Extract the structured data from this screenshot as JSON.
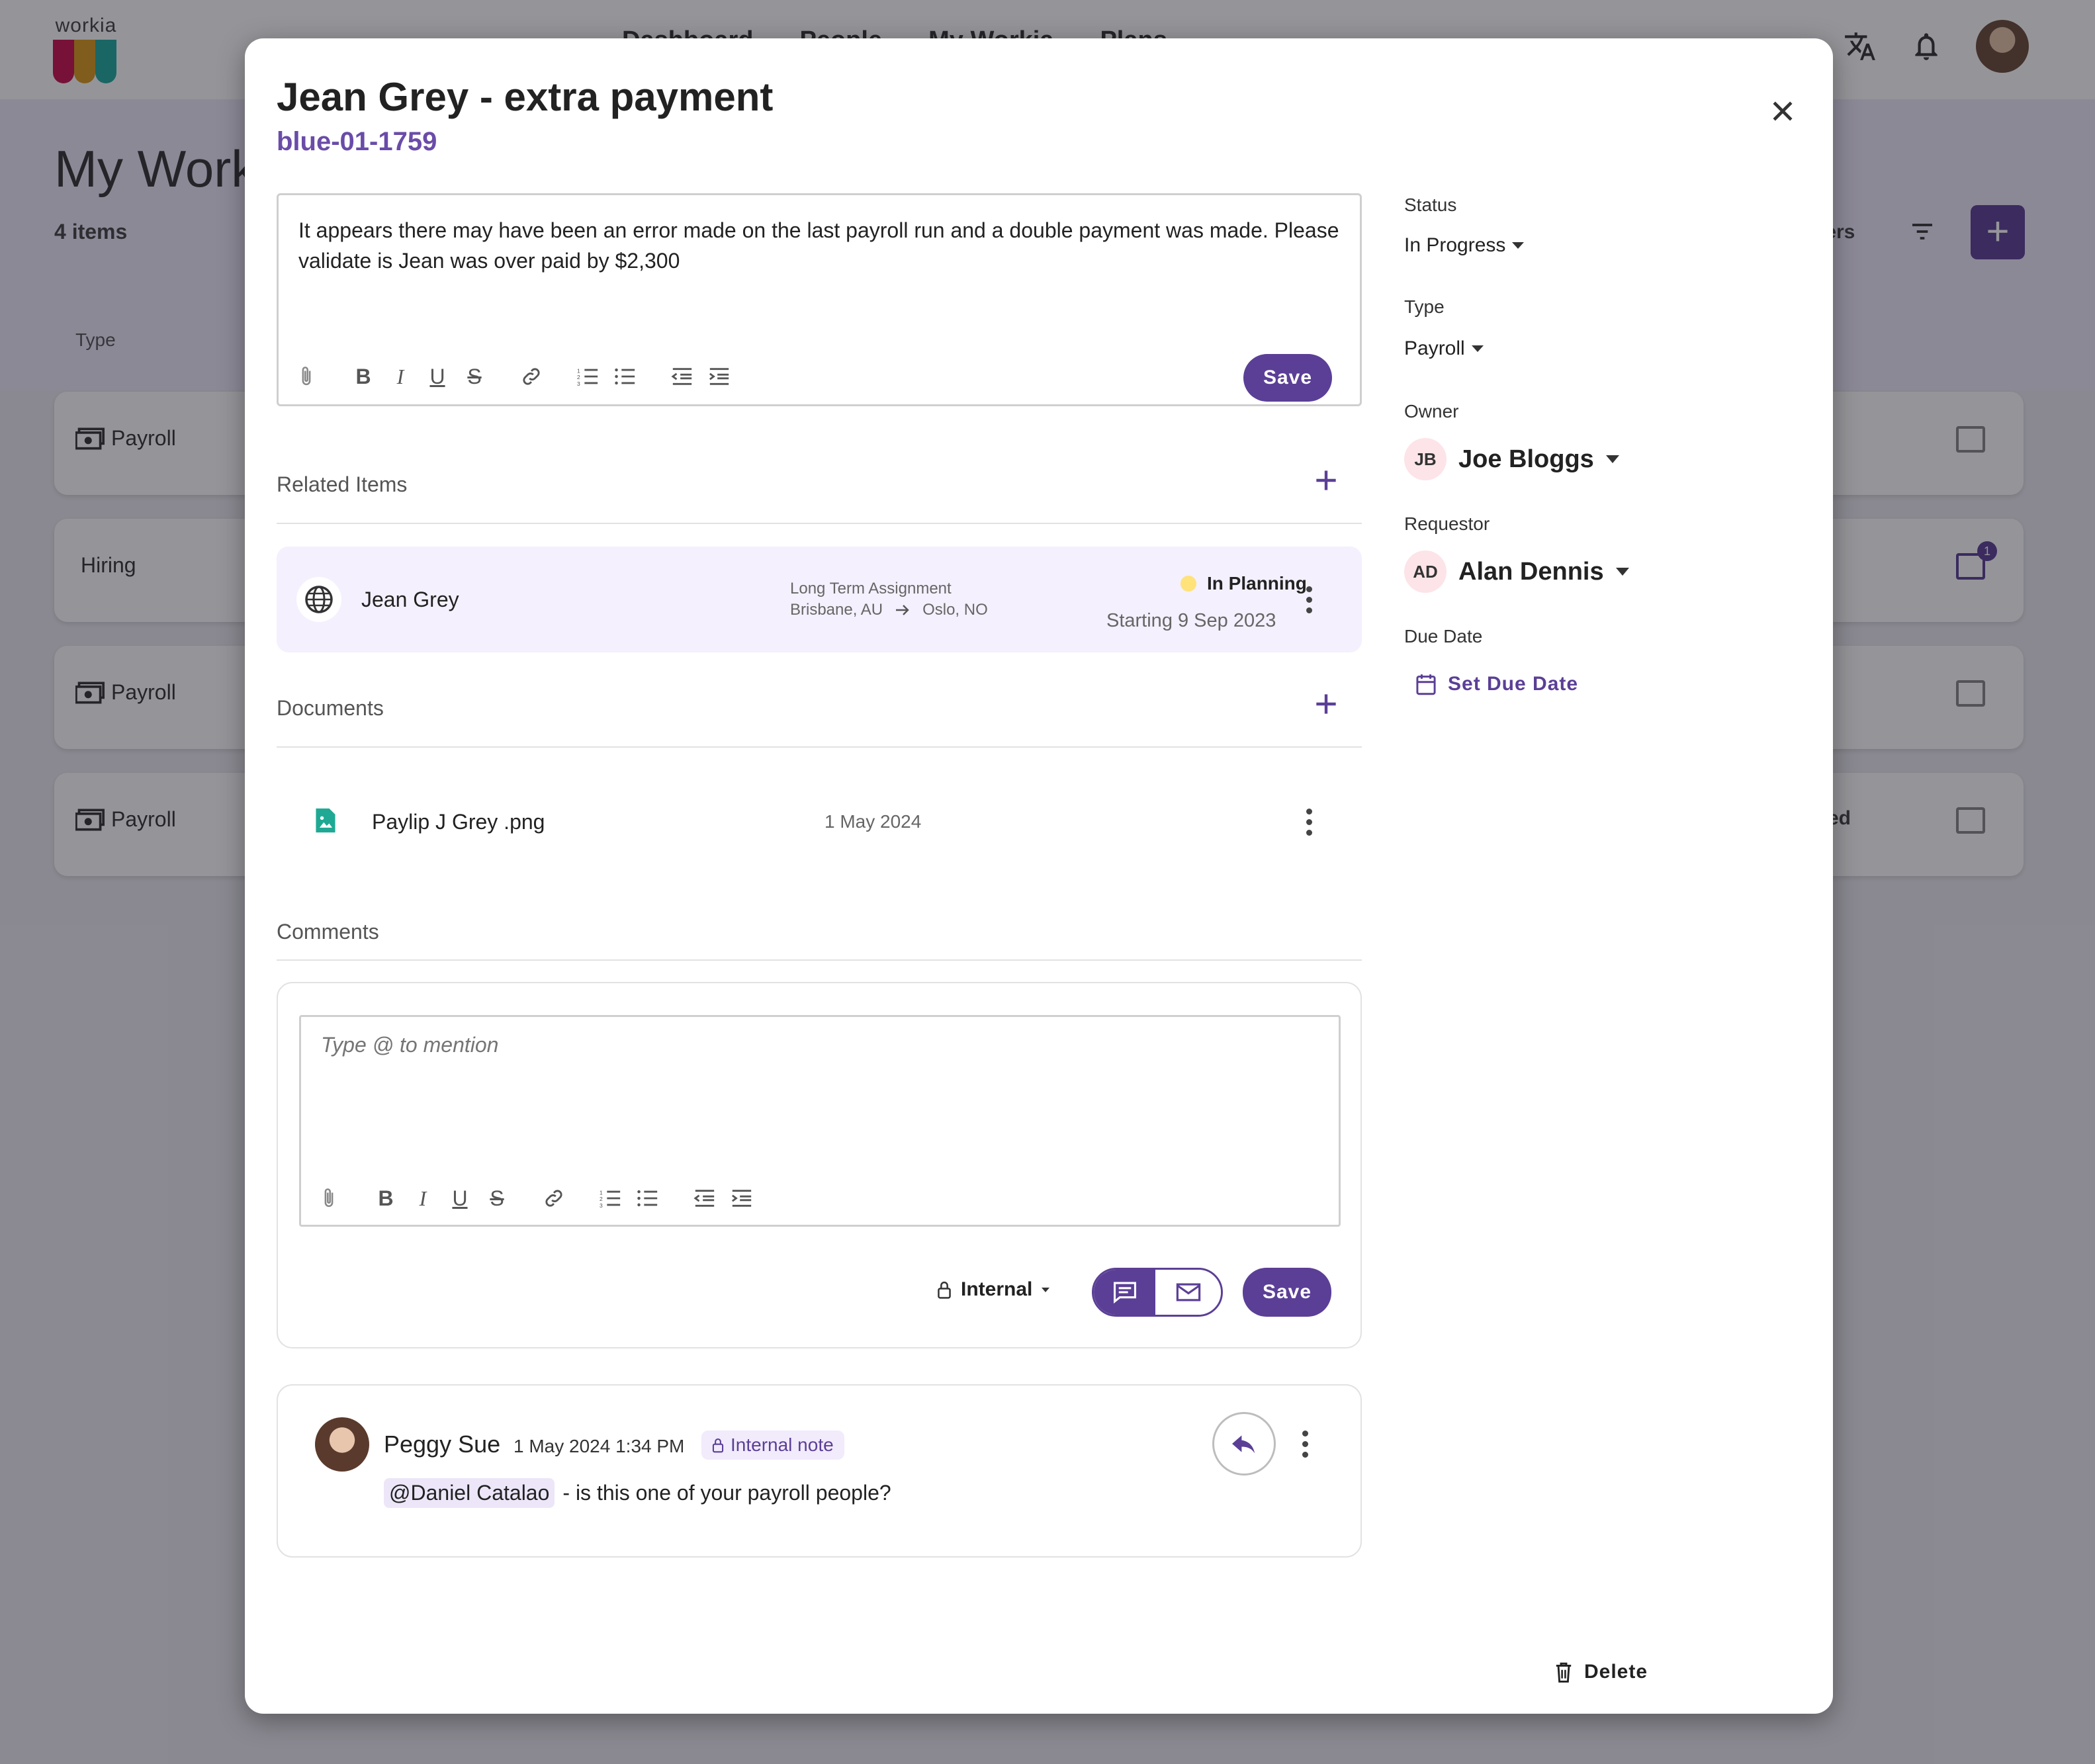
{
  "background": {
    "logo_text": "workia",
    "logo_colors": [
      "#c8104e",
      "#d99a1d",
      "#1fa9a0"
    ],
    "nav_items": [
      "Dashboard",
      "People",
      "My Workia",
      "Plans"
    ],
    "page_title": "My Worki",
    "item_count": "4 items",
    "type_header": "Type",
    "partners_fragment": "ners",
    "rows": [
      {
        "label": "Payroll",
        "icon": "money-icon",
        "badge": ""
      },
      {
        "label": "Hiring",
        "icon": "",
        "badge": "1"
      },
      {
        "label": "Payroll",
        "icon": "money-icon",
        "badge": ""
      },
      {
        "label": "Payroll",
        "icon": "money-icon",
        "badge": "",
        "tail": "ed"
      }
    ]
  },
  "modal": {
    "title": "Jean Grey - extra payment",
    "id": "blue-01-1759",
    "description": "It appears there may have been an error made on the last payroll run and a double payment was made. Please validate is Jean was over paid by $2,300",
    "save_label": "Save",
    "related": {
      "heading": "Related Items",
      "item": {
        "name": "Jean Grey",
        "assignment_type": "Long Term Assignment",
        "from": "Brisbane, AU",
        "to": "Oslo, NO",
        "status": "In Planning",
        "status_color": "#ffe27a",
        "start": "Starting 9 Sep 2023"
      }
    },
    "documents": {
      "heading": "Documents",
      "items": [
        {
          "name": "Paylip J Grey .png",
          "date": "1 May 2024"
        }
      ]
    },
    "comments": {
      "heading": "Comments",
      "placeholder": "Type @ to mention",
      "visibility": "Internal",
      "save_label": "Save",
      "entries": [
        {
          "author": "Peggy Sue",
          "time": "1 May 2024 1:34 PM",
          "badge": "Internal note",
          "mention": "@Daniel Catalao",
          "text": "- is this one of your payroll people?"
        }
      ]
    },
    "sidebar": {
      "status_label": "Status",
      "status_value": "In Progress",
      "type_label": "Type",
      "type_value": "Payroll",
      "owner_label": "Owner",
      "owner_initials": "JB",
      "owner_name": "Joe Bloggs",
      "requestor_label": "Requestor",
      "requestor_initials": "AD",
      "requestor_name": "Alan Dennis",
      "due_label": "Due Date",
      "due_action": "Set Due Date"
    },
    "delete_label": "Delete"
  },
  "colors": {
    "accent": "#5b3f96",
    "accent_light": "#f4f0fd"
  }
}
